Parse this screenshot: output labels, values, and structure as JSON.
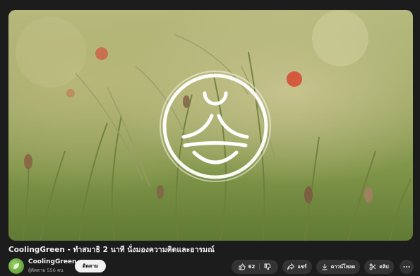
{
  "video": {
    "title": "CoolingGreen - ทำสมาธิ 2 นาที นั่งมองความคิดและอารมณ์"
  },
  "channel": {
    "name": "CoolingGreen",
    "subscribers": "ผู้ติดตาม 556 คน",
    "subscribe_label": "ติดตาม"
  },
  "actions": {
    "like_count": "62",
    "share_label": "แชร์",
    "download_label": "ดาวน์โหลด",
    "clip_label": "คลิป"
  },
  "icons": {
    "like": "thumbs-up-icon",
    "dislike": "thumbs-down-icon",
    "share": "share-arrow-icon",
    "download": "download-icon",
    "clip": "scissors-icon",
    "more": "more-horizontal-icon",
    "logo": "meditation-logo-icon"
  },
  "colors": {
    "background": "#1c1c1c",
    "text": "#f1f1f1",
    "subtext": "#aaaaaa",
    "button": "#333333",
    "subscribe_bg": "#f1f1f1"
  }
}
